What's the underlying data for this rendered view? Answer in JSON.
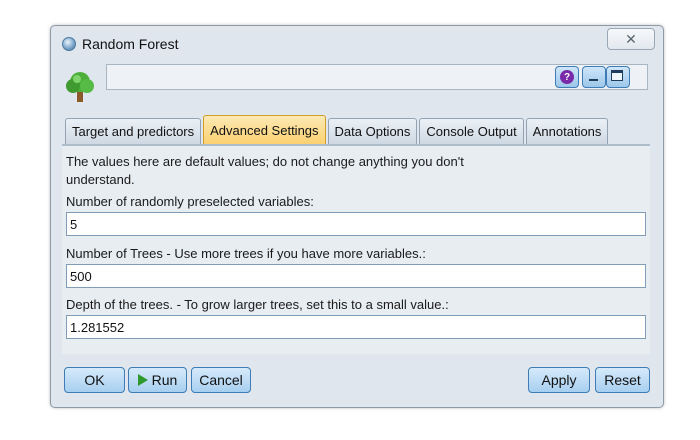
{
  "window": {
    "title": "Random Forest",
    "close_glyph": "✕",
    "icons": [
      "app-icon",
      "tree-icon",
      "help-icon",
      "minimize-icon",
      "maximize-icon",
      "close-icon"
    ]
  },
  "header": {
    "node_name_value": "",
    "help_glyph": "?"
  },
  "tabs": [
    {
      "label": "Target and predictors",
      "active": false
    },
    {
      "label": "Advanced Settings",
      "active": true
    },
    {
      "label": "Data Options",
      "active": false
    },
    {
      "label": "Console Output",
      "active": false
    },
    {
      "label": "Annotations",
      "active": false
    }
  ],
  "settings": {
    "description": "The values here are default values; do not change anything you don't understand.",
    "fields": [
      {
        "label": "Number of randomly preselected variables:",
        "value": "5"
      },
      {
        "label": "Number of Trees - Use more trees if you have more variables.:",
        "value": "500"
      },
      {
        "label": "Depth of the trees. - To grow larger trees, set this to a small value.:",
        "value": "1.281552"
      }
    ]
  },
  "buttons": {
    "ok": "OK",
    "run": "Run",
    "cancel": "Cancel",
    "apply": "Apply",
    "reset": "Reset"
  },
  "colors": {
    "active_tab": "#fbd170",
    "button": "#a7cff0",
    "run_arrow": "#2e9a2e",
    "help": "#7a2aa8",
    "tree_leaves": "#4caf3a"
  }
}
